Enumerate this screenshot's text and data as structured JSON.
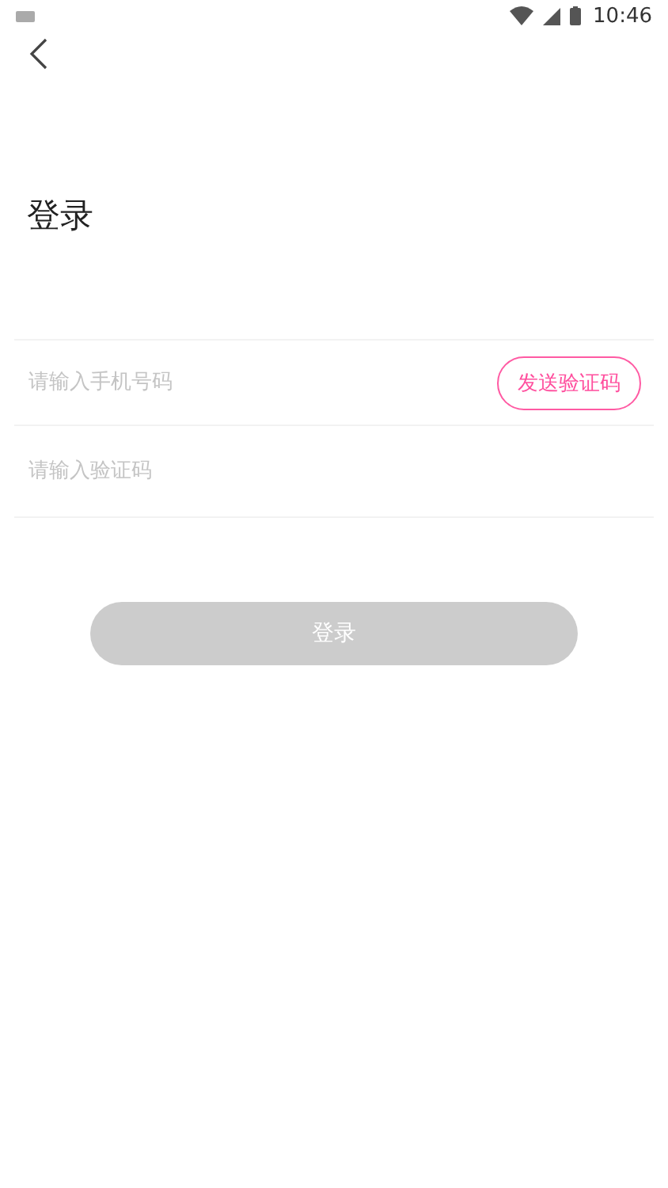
{
  "status_bar": {
    "time": "10:46"
  },
  "title": "登录",
  "phone_field": {
    "placeholder": "请输入手机号码"
  },
  "send_code_button": {
    "label": "发送验证码"
  },
  "code_field": {
    "placeholder": "请输入验证码"
  },
  "login_button": {
    "label": "登录",
    "disabled": true
  }
}
